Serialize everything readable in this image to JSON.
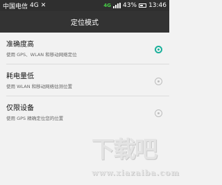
{
  "status_bar": {
    "carrier": "中国电信",
    "network_left": "4G",
    "network_right": "4G",
    "battery": "43%",
    "time": "13:46"
  },
  "app_bar": {
    "title": "定位模式"
  },
  "modes": [
    {
      "title": "准确度高",
      "description": "使用 GPS、WLAN 和移动网络定位",
      "selected": true
    },
    {
      "title": "耗电量低",
      "description": "使用 WLAN 和移动网络估测位置",
      "selected": false
    },
    {
      "title": "仅限设备",
      "description": "使用 GPS 精确定位您的位置",
      "selected": false
    }
  ],
  "watermark": {
    "main": "下载吧",
    "sub": "www.xiazaiba.com"
  },
  "colors": {
    "accent": "#1ab09b",
    "app_bar": "#333333",
    "status_bar": "#2f2f2f",
    "background": "#f2f2f2"
  }
}
